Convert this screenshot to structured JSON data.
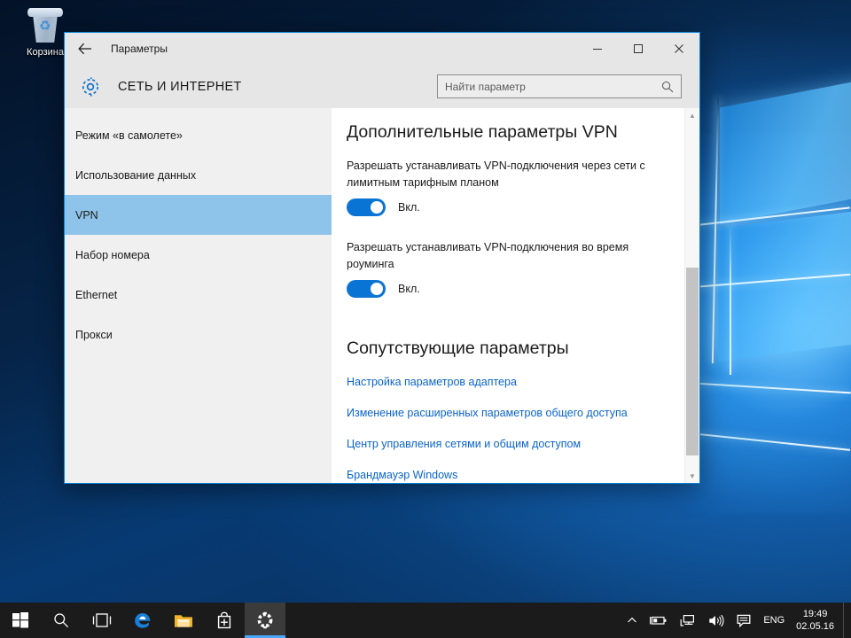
{
  "desktop": {
    "recycle_bin_label": "Корзина",
    "recycle_bin_icon": "recycle-bin-icon"
  },
  "window": {
    "title": "Параметры",
    "back_icon": "back-arrow-icon",
    "minimize_label": "─",
    "maximize_label": "☐",
    "close_label": "✕",
    "category_title": "СЕТЬ И ИНТЕРНЕТ",
    "gear_icon": "gear-icon"
  },
  "search": {
    "placeholder": "Найти параметр",
    "value": "",
    "icon": "search-icon"
  },
  "sidebar": {
    "items": [
      {
        "label": "Режим «в самолете»",
        "selected": false
      },
      {
        "label": "Использование данных",
        "selected": false
      },
      {
        "label": "VPN",
        "selected": true
      },
      {
        "label": "Набор номера",
        "selected": false
      },
      {
        "label": "Ethernet",
        "selected": false
      },
      {
        "label": "Прокси",
        "selected": false
      }
    ]
  },
  "content": {
    "heading_advanced": "Дополнительные параметры VPN",
    "settings": [
      {
        "label": "Разрешать устанавливать VPN-подключения через сети с лимитным тарифным планом",
        "state": "Вкл.",
        "on": true
      },
      {
        "label": "Разрешать устанавливать VPN-подключения во время роуминга",
        "state": "Вкл.",
        "on": true
      }
    ],
    "heading_related": "Сопутствующие параметры",
    "related_links": [
      "Настройка параметров адаптера",
      "Изменение расширенных параметров общего доступа",
      "Центр управления сетями и общим доступом",
      "Брандмауэр Windows"
    ]
  },
  "scrollbar": {
    "up_arrow": "▲",
    "down_arrow": "▼"
  },
  "taskbar": {
    "buttons": [
      {
        "name": "start-button",
        "icon": "windows-logo-icon"
      },
      {
        "name": "search-button",
        "icon": "search-icon"
      },
      {
        "name": "task-view-button",
        "icon": "task-view-icon"
      },
      {
        "name": "edge-button",
        "icon": "edge-icon"
      },
      {
        "name": "file-explorer-button",
        "icon": "folder-icon"
      },
      {
        "name": "store-button",
        "icon": "store-bag-icon"
      },
      {
        "name": "settings-button",
        "icon": "gear-icon",
        "active": true
      }
    ],
    "tray": {
      "chevron": "∧",
      "battery_icon": "battery-icon",
      "network_icon": "network-icon",
      "volume_icon": "volume-icon",
      "action_center_icon": "action-center-icon",
      "language": "ENG",
      "time": "19:49",
      "date": "02.05.16"
    }
  },
  "colors": {
    "accent": "#0a74d4",
    "selected_nav": "#8fc4ea",
    "link": "#0a64c8",
    "window_border": "#0a84d8",
    "taskbar_bg": "#1b1b1b"
  }
}
